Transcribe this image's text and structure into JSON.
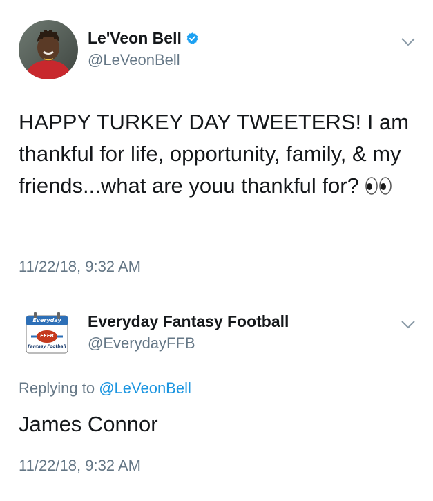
{
  "colors": {
    "text": "#14171a",
    "secondary": "#657786",
    "link": "#1b95e0",
    "verified": "#1da1f2",
    "divider": "#d0d6db"
  },
  "tweets": [
    {
      "author": {
        "name": "Le'Veon Bell",
        "handle": "@LeVeonBell",
        "verified": true,
        "avatar": "player-photo-avatar"
      },
      "text": "HAPPY TURKEY DAY TWEETERS! I am thankful for life, opportunity, family, & my friends...what are youu thankful for?",
      "emoji": "eyes-emoji",
      "timestamp": "11/22/18, 9:32 AM",
      "menu_icon": "chevron-down-icon"
    },
    {
      "author": {
        "name": "Everyday Fantasy Football",
        "handle": "@EverydayFFB",
        "verified": false,
        "avatar": "efff-logo-avatar",
        "logo_text": {
          "top": "Everyday",
          "middle": "EFFB",
          "bottom": "Fantasy Football"
        }
      },
      "replying_prefix": "Replying to",
      "replying_to": "@LeVeonBell",
      "text": "James Connor",
      "timestamp": "11/22/18, 9:32 AM",
      "menu_icon": "chevron-down-icon"
    }
  ]
}
